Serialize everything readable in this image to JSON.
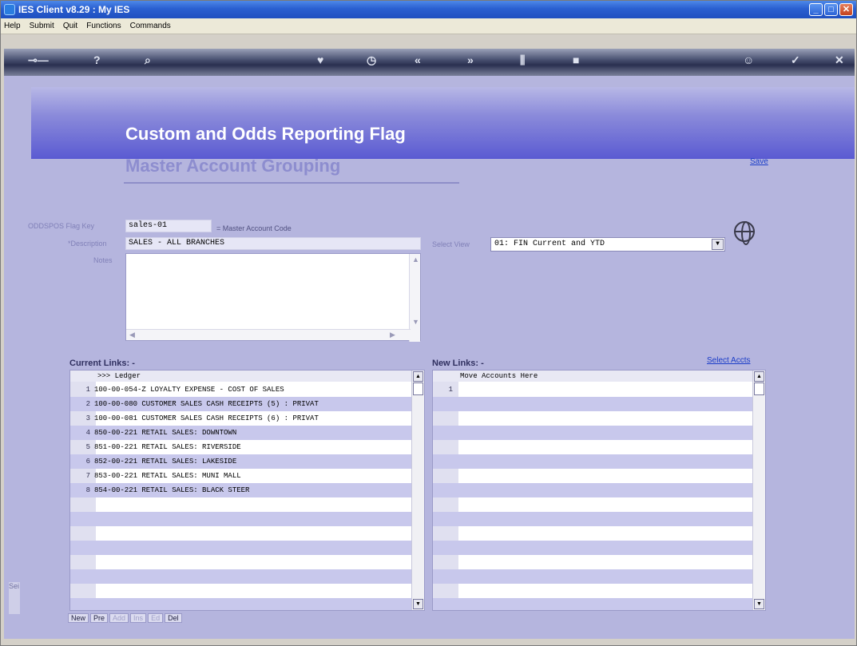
{
  "window": {
    "title": "IES Client v8.29 : My IES"
  },
  "menu": [
    "Help",
    "Submit",
    "Quit",
    "Functions",
    "Commands"
  ],
  "toolbar": [
    "key-icon",
    "help-icon",
    "search-icon",
    "heart-icon",
    "clock-icon",
    "rewind-icon",
    "fastforward-icon",
    "columns-icon",
    "stop-icon",
    "smile-icon",
    "check-icon",
    "close-icon"
  ],
  "header": {
    "title": "Custom and Odds Reporting Flag",
    "subtitle": "Master Account Grouping",
    "save_label": "Save"
  },
  "form": {
    "flagkey_label": "ODDSPOS Flag Key",
    "flagkey_value": "sales-01",
    "flagkey_hint": "= Master Account Code",
    "description_label": "*Description",
    "description_value": "SALES - ALL BRANCHES",
    "notes_label": "Notes",
    "notes_value": ""
  },
  "view": {
    "label": "Select View",
    "selected": "01: FIN Current and YTD"
  },
  "current_links": {
    "label": "Current Links: -",
    "column_header": ">>> Ledger",
    "rows": [
      {
        "num": "1",
        "text": "100-00-054-Z LOYALTY EXPENSE - COST OF SALES"
      },
      {
        "num": "2",
        "text": "100-00-080 CUSTOMER SALES CASH RECEIPTS (5) : PRIVAT"
      },
      {
        "num": "3",
        "text": "100-00-081 CUSTOMER SALES CASH RECEIPTS (6) : PRIVAT"
      },
      {
        "num": "4",
        "text": "850-00-221 RETAIL SALES: DOWNTOWN"
      },
      {
        "num": "5",
        "text": "851-00-221 RETAIL SALES: RIVERSIDE"
      },
      {
        "num": "6",
        "text": "852-00-221 RETAIL SALES: LAKESIDE"
      },
      {
        "num": "7",
        "text": "853-00-221 RETAIL SALES: MUNI MALL"
      },
      {
        "num": "8",
        "text": "854-00-221 RETAIL SALES: BLACK STEER"
      }
    ]
  },
  "new_links": {
    "label": "New Links: -",
    "select_label": "Select Accts",
    "column_header": "Move Accounts Here",
    "rows": [
      {
        "num": "1",
        "text": ""
      }
    ]
  },
  "navbar": [
    "New",
    "Pre",
    "Add",
    "Ins",
    "Ed",
    "Del"
  ],
  "side_tab": "Sei"
}
